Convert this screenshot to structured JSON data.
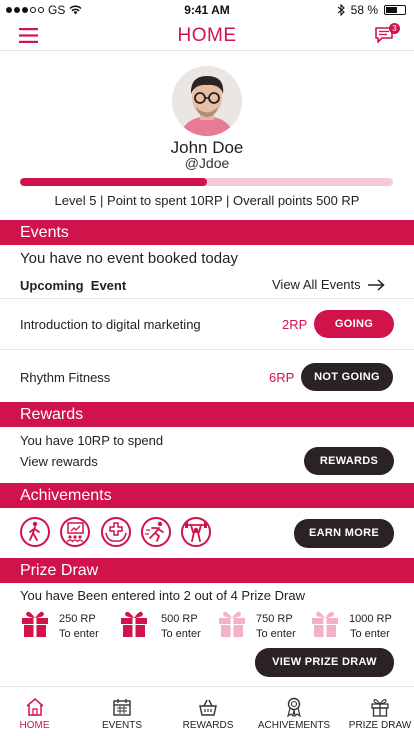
{
  "status_bar": {
    "carrier": "GS",
    "time": "9:41 AM",
    "battery": "58 %"
  },
  "header": {
    "title": "HOME",
    "message_badge": "3"
  },
  "profile": {
    "name": "John Doe",
    "handle": "@Jdoe",
    "level_progress": 0.5,
    "level_line": "Level 5 | Point to spent 10RP | Overall points 500 RP"
  },
  "events": {
    "section_title": "Events",
    "no_event_text": "You have no event booked today",
    "upcoming_label": "Upcoming  Event",
    "view_all_label": "View All Events",
    "items": [
      {
        "title": "Introduction to digital marketing",
        "points": "2RP",
        "button": "GOING"
      },
      {
        "title": "Rhythm Fitness",
        "points": "6RP",
        "button": "NOT GOING"
      }
    ]
  },
  "rewards": {
    "section_title": "Rewards",
    "spend_text": "You have 10RP to spend",
    "view_text": "View rewards",
    "button": "REWARDS"
  },
  "achievements": {
    "section_title": "Achivements",
    "icons": [
      "walking-person-icon",
      "presentation-icon",
      "medical-hands-icon",
      "running-person-icon",
      "weightlifting-icon"
    ],
    "button": "EARN MORE"
  },
  "prize_draw": {
    "section_title": "Prize Draw",
    "entered_text": "You have Been entered into 2 out of 4 Prize Draw",
    "prizes": [
      {
        "points": "250 RP",
        "label": "To enter",
        "entered": true
      },
      {
        "points": "500 RP",
        "label": "To enter",
        "entered": true
      },
      {
        "points": "750 RP",
        "label": "To enter",
        "entered": false
      },
      {
        "points": "1000 RP",
        "label": "To enter",
        "entered": false
      }
    ],
    "button": "VIEW PRIZE DRAW"
  },
  "tabs": [
    {
      "label": "HOME",
      "icon": "house-icon",
      "active": true
    },
    {
      "label": "EVENTS",
      "icon": "calendar-icon",
      "active": false
    },
    {
      "label": "REWARDS",
      "icon": "shopping-basket-icon",
      "active": false
    },
    {
      "label": "ACHIVEMENTS",
      "icon": "medal-icon",
      "active": false
    },
    {
      "label": "PRIZE DRAW",
      "icon": "gift-icon",
      "active": false
    }
  ],
  "colors": {
    "accent": "#d0134a",
    "accent_light": "#f7c9d5",
    "dark": "#2a2223"
  }
}
